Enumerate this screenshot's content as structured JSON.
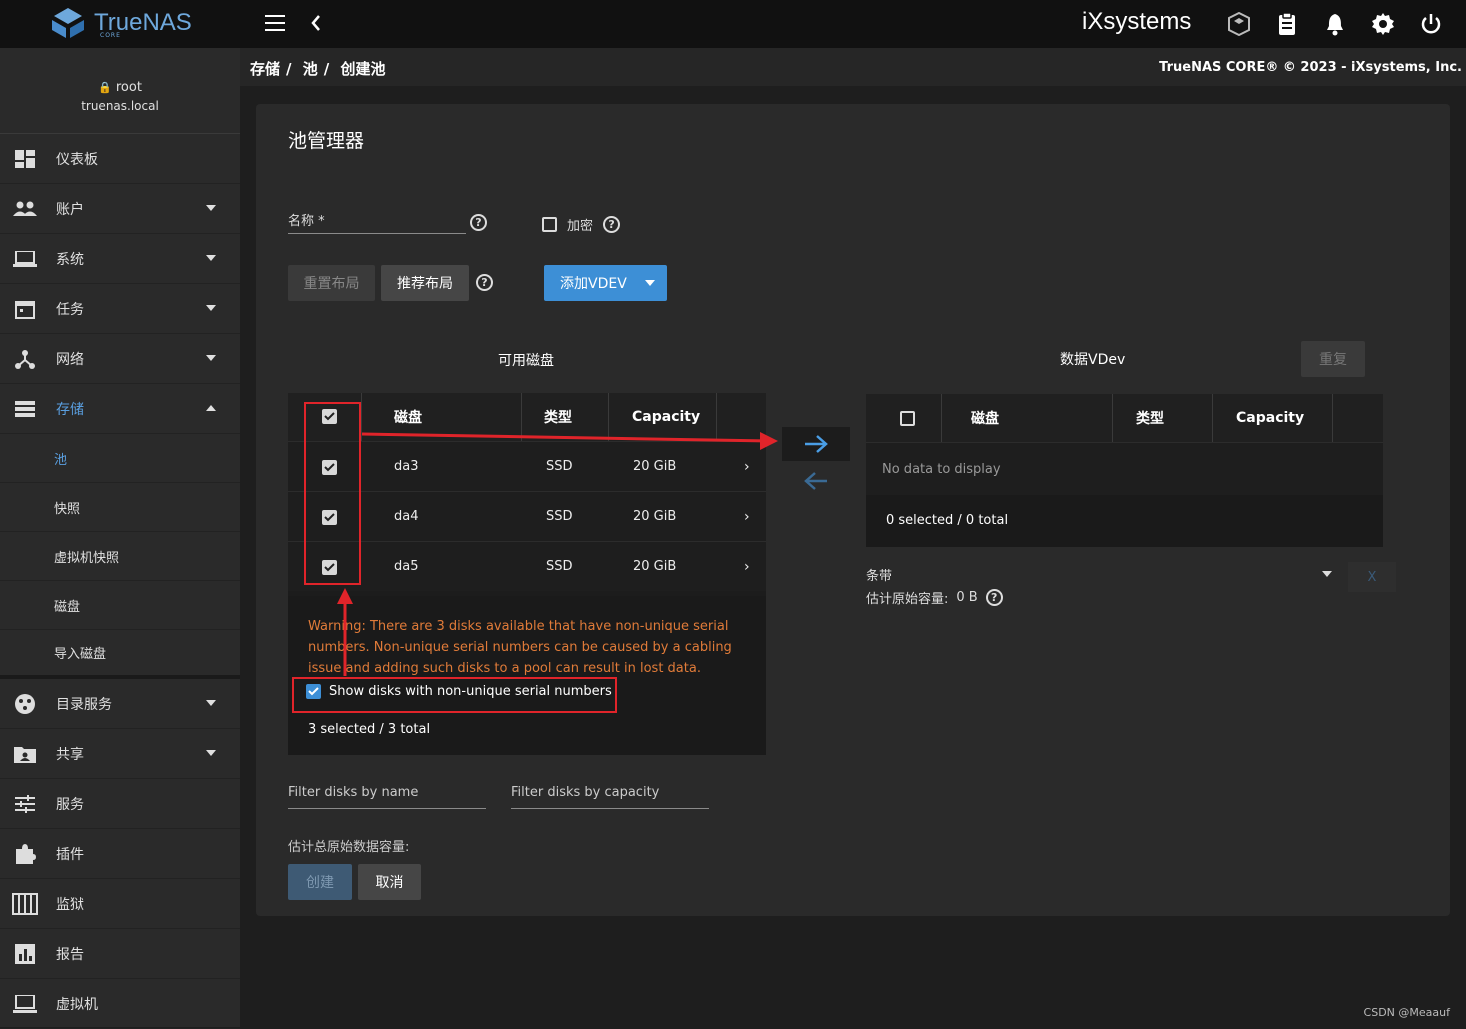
{
  "topbar": {
    "logo_text": "TrueNAS",
    "logo_sub": "CORE",
    "ix_logo": "iXsystems",
    "icons": [
      "truecommand-icon",
      "clipboard-icon",
      "bell-icon",
      "gear-icon",
      "power-icon"
    ]
  },
  "user": {
    "name": "root",
    "host": "truenas.local"
  },
  "nav": {
    "dashboard": "仪表板",
    "accounts": "账户",
    "system": "系统",
    "tasks": "任务",
    "network": "网络",
    "storage": "存储",
    "pools": "池",
    "snapshots": "快照",
    "vm_snapshots": "虚拟机快照",
    "disks": "磁盘",
    "import_disk": "导入磁盘",
    "directory": "目录服务",
    "sharing": "共享",
    "services": "服务",
    "plugins": "插件",
    "jails": "监狱",
    "reporting": "报告",
    "vms": "虚拟机"
  },
  "breadcrumb": {
    "a": "存储",
    "b": "池",
    "c": "创建池",
    "sep": "/"
  },
  "copyright": "TrueNAS CORE® © 2023 - iXsystems, Inc.",
  "card": {
    "title": "池管理器",
    "name_label": "名称 *",
    "encrypt_label": "加密",
    "reset_layout": "重置布局",
    "suggest_layout": "推荐布局",
    "add_vdev": "添加VDEV",
    "available_disks": "可用磁盘",
    "data_vdev": "数据VDev",
    "repeat": "重复",
    "left_table": {
      "headers": [
        "磁盘",
        "类型",
        "Capacity"
      ],
      "rows": [
        {
          "disk": "da3",
          "type": "SSD",
          "capacity": "20 GiB"
        },
        {
          "disk": "da4",
          "type": "SSD",
          "capacity": "20 GiB"
        },
        {
          "disk": "da5",
          "type": "SSD",
          "capacity": "20 GiB"
        }
      ],
      "warning": "Warning: There are 3 disks available that have non-unique serial numbers. Non-unique serial numbers can be caused by a cabling issue and adding such disks to a pool can result in lost data.",
      "show_nonunique": "Show disks with non-unique serial numbers",
      "footer": "3 selected / 3 total"
    },
    "right_table": {
      "headers": [
        "磁盘",
        "类型",
        "Capacity"
      ],
      "empty": "No data to display",
      "footer": "0 selected / 0 total"
    },
    "vdev_type": "条带",
    "est_raw_label": "估计原始容量:",
    "est_raw_value": "0 B",
    "remove_x": "X",
    "filter_name": "Filter disks by name",
    "filter_capacity": "Filter disks by capacity",
    "est_total_label": "估计总原始数据容量:",
    "create": "创建",
    "cancel": "取消"
  },
  "watermark": "CSDN @Meaauf",
  "colors": {
    "accent": "#3d8fd6",
    "annotation": "#e0242a",
    "warning": "#e07b39"
  }
}
